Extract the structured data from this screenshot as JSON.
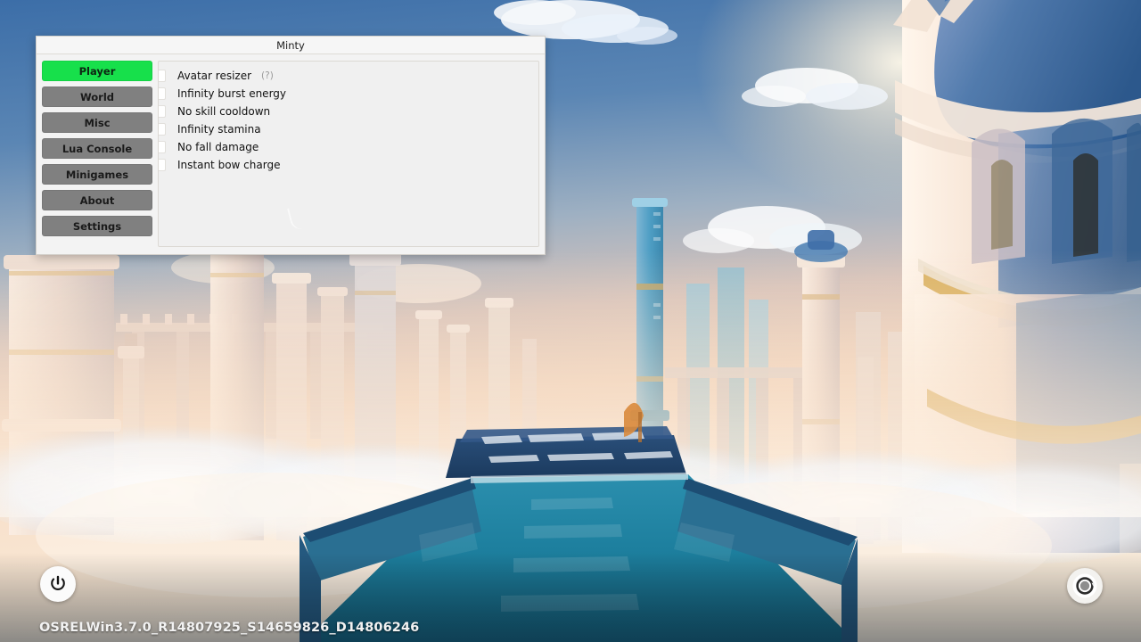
{
  "window": {
    "title": "Minty"
  },
  "sidebar": {
    "items": [
      {
        "label": "Player",
        "active": true,
        "name": "sidebar-item-player"
      },
      {
        "label": "World",
        "active": false,
        "name": "sidebar-item-world"
      },
      {
        "label": "Misc",
        "active": false,
        "name": "sidebar-item-misc"
      },
      {
        "label": "Lua Console",
        "active": false,
        "name": "sidebar-item-lua-console"
      },
      {
        "label": "Minigames",
        "active": false,
        "name": "sidebar-item-minigames"
      },
      {
        "label": "About",
        "active": false,
        "name": "sidebar-item-about"
      },
      {
        "label": "Settings",
        "active": false,
        "name": "sidebar-item-settings"
      }
    ]
  },
  "content": {
    "options": [
      {
        "label": "Avatar resizer",
        "checked": false,
        "hint": "(?)"
      },
      {
        "label": "Infinity burst energy",
        "checked": false,
        "hint": ""
      },
      {
        "label": "No skill cooldown",
        "checked": false,
        "hint": ""
      },
      {
        "label": "Infinity stamina",
        "checked": false,
        "hint": ""
      },
      {
        "label": "No fall damage",
        "checked": false,
        "hint": ""
      },
      {
        "label": "Instant bow charge",
        "checked": false,
        "hint": ""
      }
    ]
  },
  "overlay": {
    "version_text": "OSRELWin3.7.0_R14807925_S14659826_D14806246",
    "power_button_icon": "power-icon",
    "record_button_icon": "record-icon"
  },
  "colors": {
    "accent_green": "#17e04b",
    "nav_gray": "#808080",
    "window_bg": "#f3f3f3",
    "panel_bg": "#f0f0f0",
    "sky_blue": "#3a6ea8",
    "haze_gold": "#f6d7bc",
    "platform_teal": "#1d7f9e"
  },
  "scene": {
    "description": "celestial-city-skyline"
  }
}
